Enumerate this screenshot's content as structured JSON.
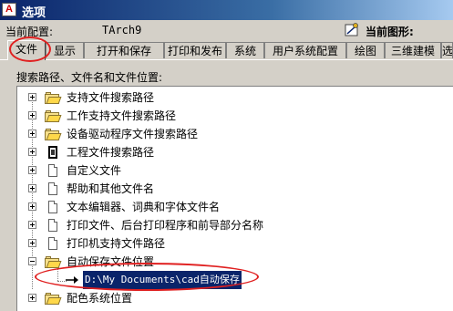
{
  "window": {
    "title": "选项"
  },
  "profile": {
    "label": "当前配置:",
    "value": "TArch9"
  },
  "drawing": {
    "label": "当前图形:"
  },
  "tabs": [
    {
      "label": "文件"
    },
    {
      "label": "显示"
    },
    {
      "label": "打开和保存"
    },
    {
      "label": "打印和发布"
    },
    {
      "label": "系统"
    },
    {
      "label": "用户系统配置"
    },
    {
      "label": "绘图"
    },
    {
      "label": "三维建模"
    },
    {
      "label": "选"
    }
  ],
  "section": {
    "label": "搜索路径、文件名和文件位置:"
  },
  "tree": {
    "items": [
      {
        "label": "支持文件搜索路径",
        "icon": "folder-icon",
        "expander": "plus"
      },
      {
        "label": "工作支持文件搜索路径",
        "icon": "folder-icon",
        "expander": "plus"
      },
      {
        "label": "设备驱动程序文件搜索路径",
        "icon": "folder-icon",
        "expander": "plus"
      },
      {
        "label": "工程文件搜索路径",
        "icon": "project-icon",
        "expander": "plus"
      },
      {
        "label": "自定义文件",
        "icon": "document-icon",
        "expander": "plus"
      },
      {
        "label": "帮助和其他文件名",
        "icon": "document-icon",
        "expander": "plus"
      },
      {
        "label": "文本编辑器、词典和字体文件名",
        "icon": "document-icon",
        "expander": "plus"
      },
      {
        "label": "打印文件、后台打印程序和前导部分名称",
        "icon": "document-icon",
        "expander": "plus"
      },
      {
        "label": "打印机支持文件路径",
        "icon": "document-icon",
        "expander": "plus"
      },
      {
        "label": "自动保存文件位置",
        "icon": "folder-icon",
        "expander": "minus"
      },
      {
        "label": "D:\\My Documents\\cad自动保存",
        "icon": "arrow-icon",
        "expander": "none"
      },
      {
        "label": "配色系统位置",
        "icon": "folder-icon",
        "expander": "plus"
      }
    ]
  },
  "footer": {
    "ellipsis": "..."
  },
  "colors": {
    "highlight": "#0a246a",
    "annotation": "#e02020",
    "dialog": "#d4d0c8"
  }
}
